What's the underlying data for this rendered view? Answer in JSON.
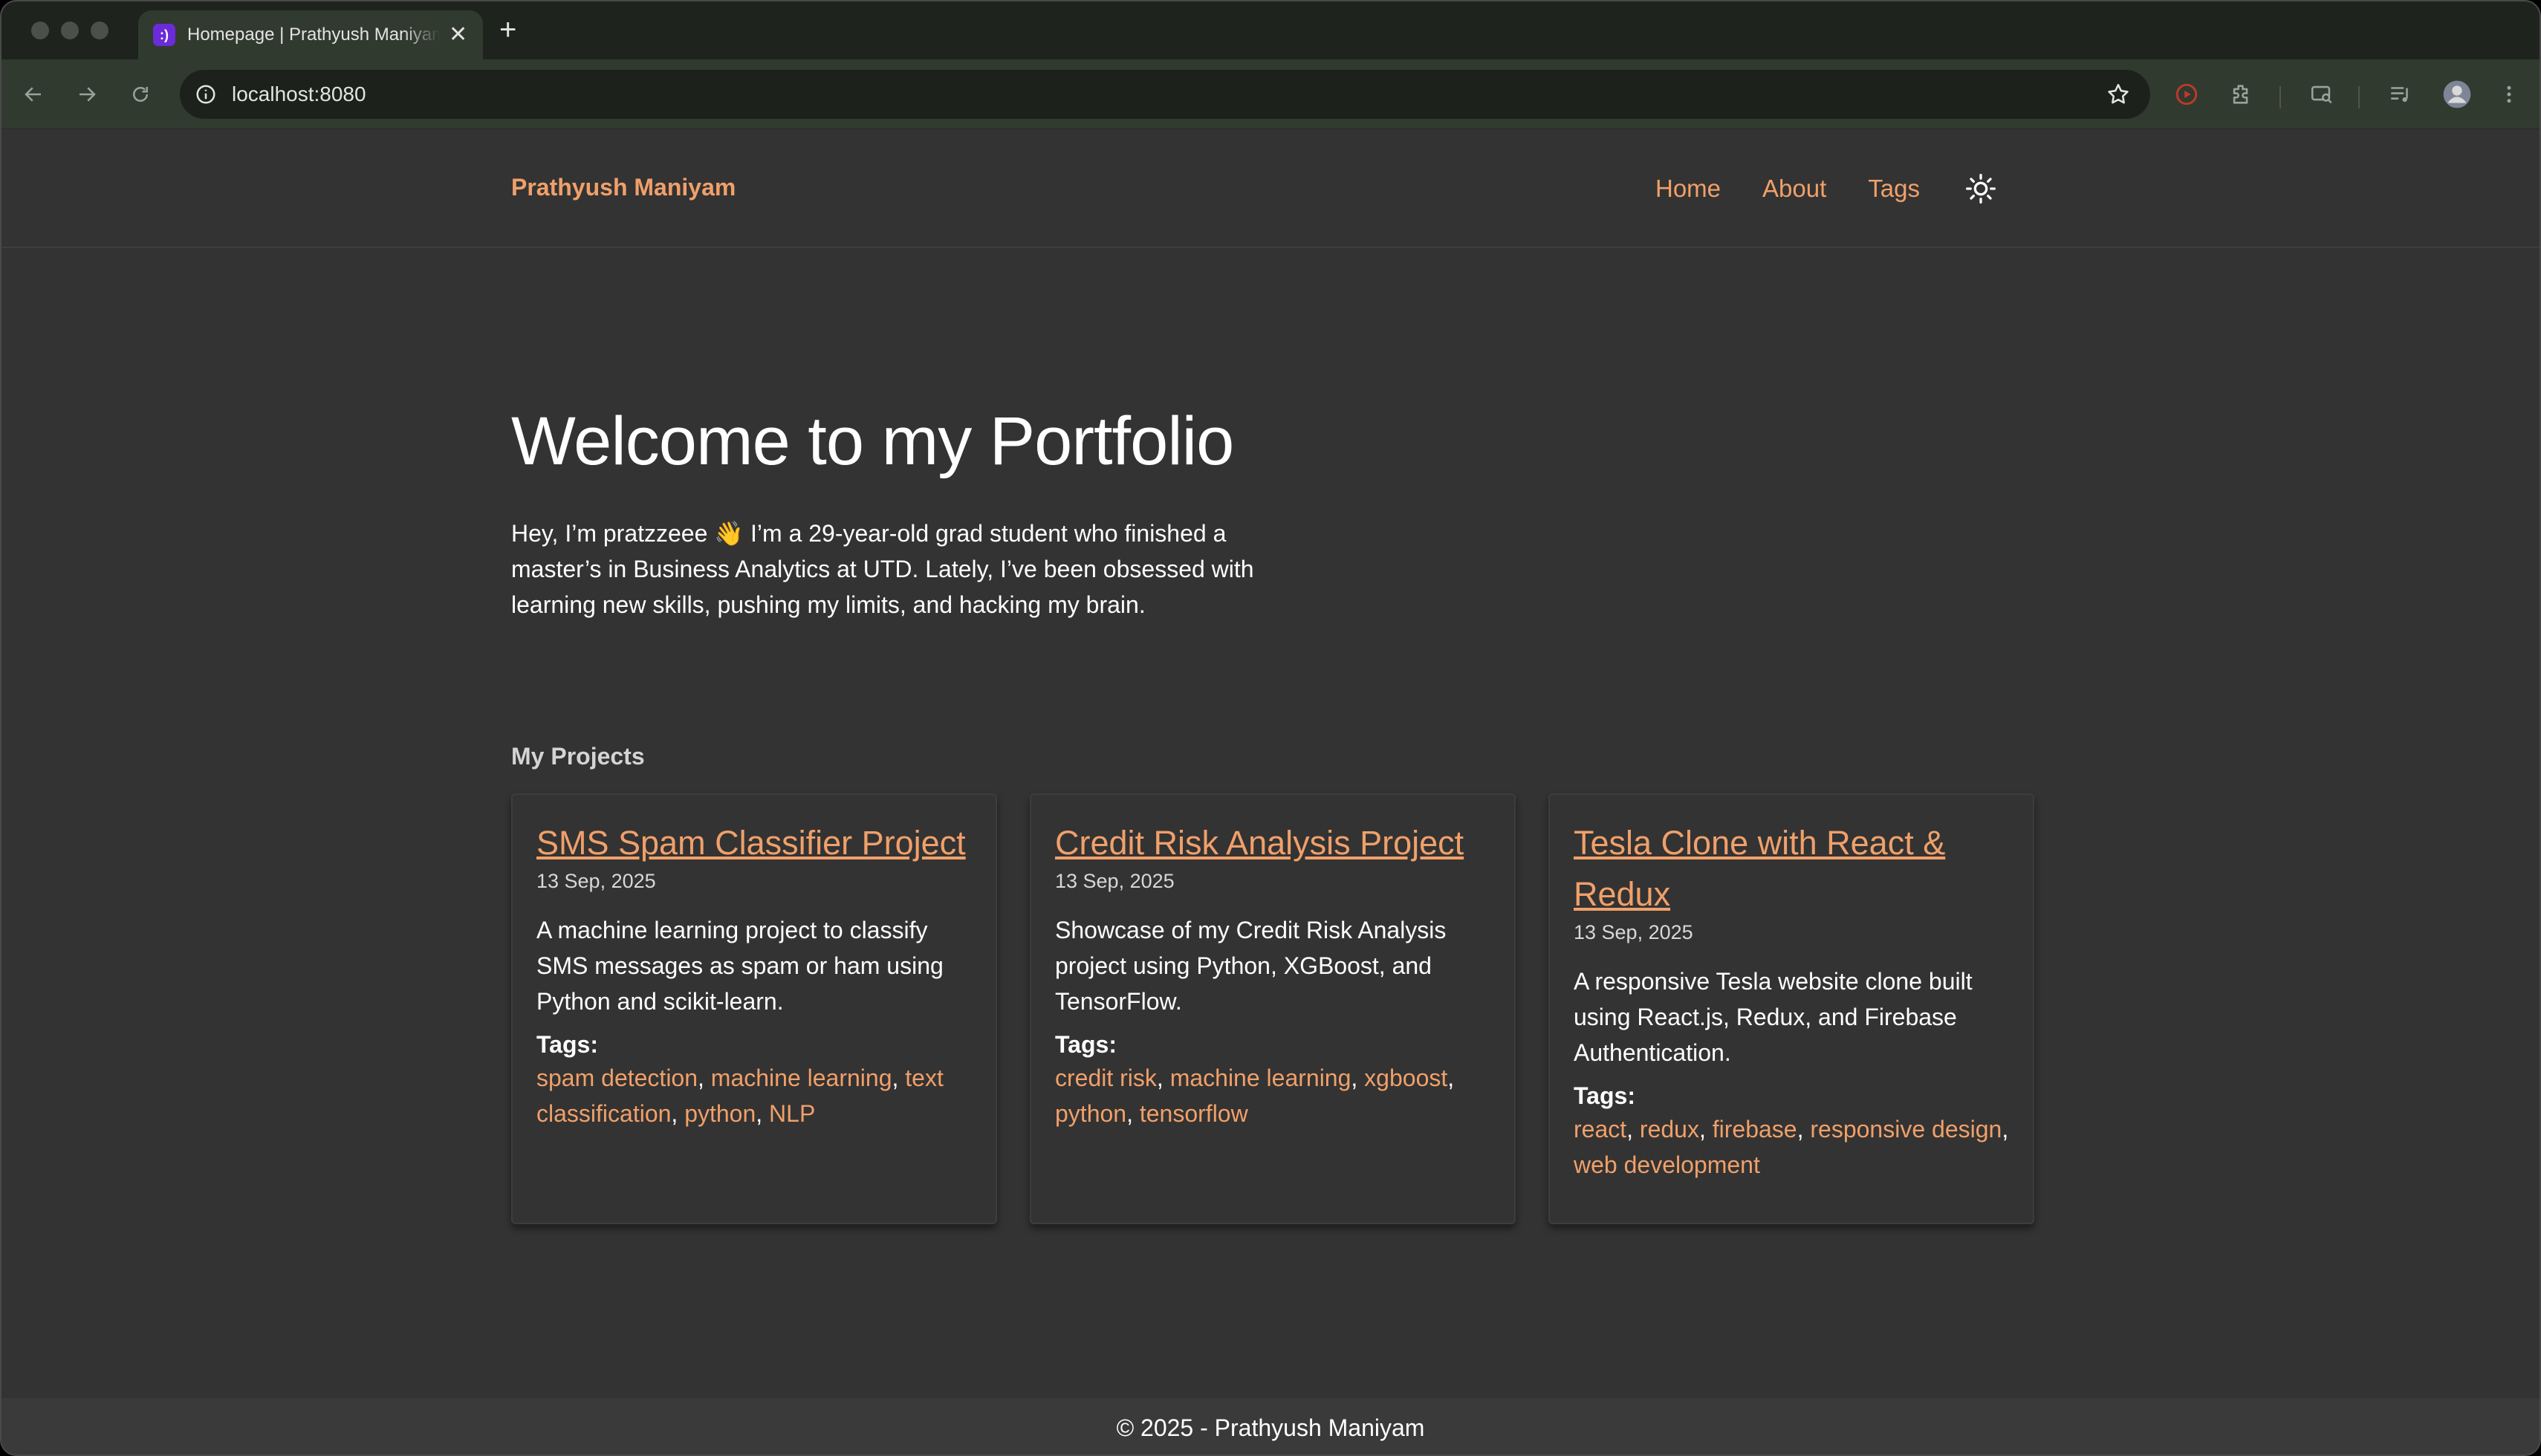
{
  "browser": {
    "tab_title": "Homepage | Prathyush Maniyam",
    "favicon_glyph": ":)",
    "new_tab_label": "+",
    "close_tab_label": "✕",
    "url": "localhost:8080"
  },
  "site": {
    "brand": "Prathyush Maniyam",
    "nav": [
      {
        "label": "Home"
      },
      {
        "label": "About"
      },
      {
        "label": "Tags"
      }
    ],
    "theme_icon": "sun-icon"
  },
  "hero": {
    "title": "Welcome to my Portfolio",
    "text": "Hey, I’m pratzzeee 👋 I’m a 29-year-old grad student who finished a master’s in Business Analytics at UTD. Lately, I’ve been obsessed with learning new skills, pushing my limits, and hacking my brain."
  },
  "projects": {
    "heading": "My Projects",
    "tags_label": "Tags:",
    "items": [
      {
        "title": "SMS Spam Classifier Project",
        "date": "13 Sep, 2025",
        "description": "A machine learning project to classify SMS messages as spam or ham using Python and scikit-learn.",
        "tags": [
          "spam detection",
          "machine learning",
          "text classification",
          "python",
          "NLP"
        ]
      },
      {
        "title": "Credit Risk Analysis Project",
        "date": "13 Sep, 2025",
        "description": "Showcase of my Credit Risk Analysis project using Python, XGBoost, and TensorFlow.",
        "tags": [
          "credit risk",
          "machine learning",
          "xgboost",
          "python",
          "tensorflow"
        ]
      },
      {
        "title": "Tesla Clone with React & Redux",
        "date": "13 Sep, 2025",
        "description": "A responsive Tesla website clone built using React.js, Redux, and Firebase Authentication.",
        "tags": [
          "react",
          "redux",
          "firebase",
          "responsive design",
          "web development"
        ]
      }
    ]
  },
  "footer": {
    "text": "© 2025 - Prathyush Maniyam"
  },
  "colors": {
    "accent": "#f0a06a",
    "page_bg": "#333333",
    "chrome_bg": "#313a2f"
  }
}
